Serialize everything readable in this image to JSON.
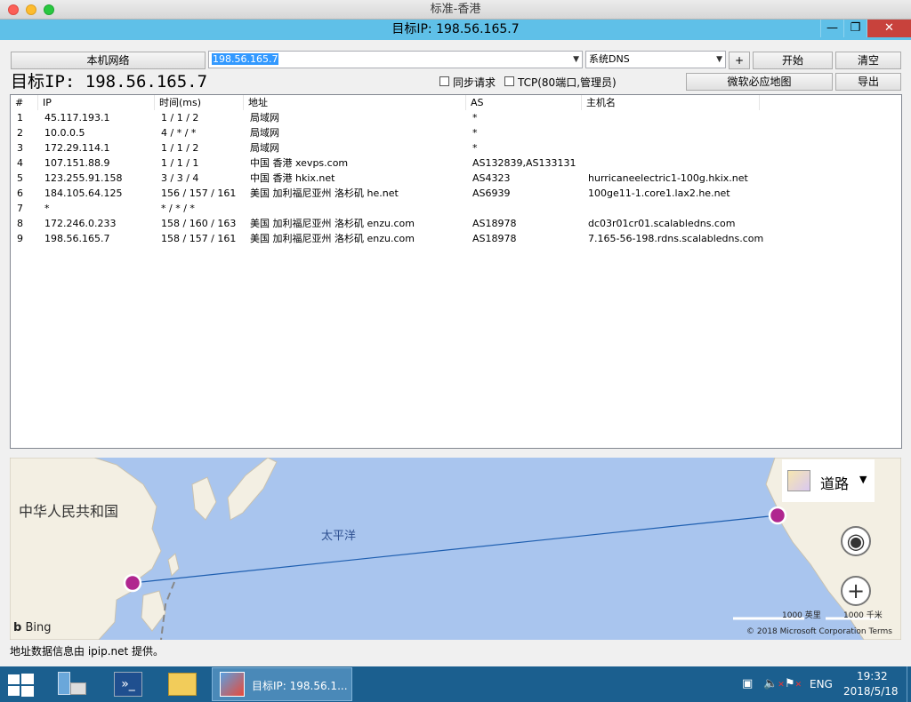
{
  "mac_title": "标准-香港",
  "window_title": "目标IP: 198.56.165.7",
  "window_controls": {
    "minimize": "—",
    "restore": "❐",
    "close": "✕"
  },
  "toolbar": {
    "network_button": "本机网络",
    "target_input": "198.56.165.7",
    "dns_select": "系统DNS",
    "plus_button": "+",
    "start_button": "开始",
    "clear_button": "清空",
    "map_button": "微软必应地图",
    "export_button": "导出"
  },
  "target_display": "目标IP: 198.56.165.7",
  "options": {
    "sync": "同步请求",
    "tcp": "TCP(80端口,管理员)"
  },
  "table": {
    "headers": [
      "#",
      "IP",
      "时间(ms)",
      "地址",
      "AS",
      "主机名"
    ],
    "rows": [
      [
        "1",
        "45.117.193.1",
        "1 / 1 / 2",
        "局域网",
        "*",
        ""
      ],
      [
        "2",
        "10.0.0.5",
        "4 / * / *",
        "局域网",
        "*",
        ""
      ],
      [
        "3",
        "172.29.114.1",
        "1 / 1 / 2",
        "局域网",
        "*",
        ""
      ],
      [
        "4",
        "107.151.88.9",
        "1 / 1 / 1",
        "中国 香港 xevps.com",
        "AS132839,AS133131",
        ""
      ],
      [
        "5",
        "123.255.91.158",
        "3 / 3 / 4",
        "中国 香港 hkix.net",
        "AS4323",
        "hurricaneelectric1-100g.hkix.net"
      ],
      [
        "6",
        "184.105.64.125",
        "156 / 157 / 161",
        "美国 加利福尼亚州 洛杉矶 he.net",
        "AS6939",
        "100ge11-1.core1.lax2.he.net"
      ],
      [
        "7",
        "*",
        "* / * / *",
        "",
        "",
        ""
      ],
      [
        "8",
        "172.246.0.233",
        "158 / 160 / 163",
        "美国 加利福尼亚州 洛杉矶 enzu.com",
        "AS18978",
        "dc03r01cr01.scalabledns.com"
      ],
      [
        "9",
        "198.56.165.7",
        "158 / 157 / 161",
        "美国 加利福尼亚州 洛杉矶 enzu.com",
        "AS18978",
        "7.165-56-198.rdns.scalabledns.com"
      ]
    ]
  },
  "map": {
    "country_label": "中华人民共和国",
    "ocean_label": "太平洋",
    "layer_label": "道路",
    "scale_miles": "1000 英里",
    "scale_km": "1000 千米",
    "brand": "Bing",
    "copyright": "© 2018 Microsoft Corporation  Terms"
  },
  "status_text": "地址数据信息由 ipip.net 提供。",
  "taskbar": {
    "app_label": "目标IP: 198.56.1...",
    "lang": "ENG",
    "time": "19:32",
    "date": "2018/5/18"
  },
  "colors": {
    "window_bar": "#5fc0e8",
    "taskbar": "#1b5f8f",
    "route_point": "#b0268f",
    "ocean": "#a9c5ee"
  }
}
